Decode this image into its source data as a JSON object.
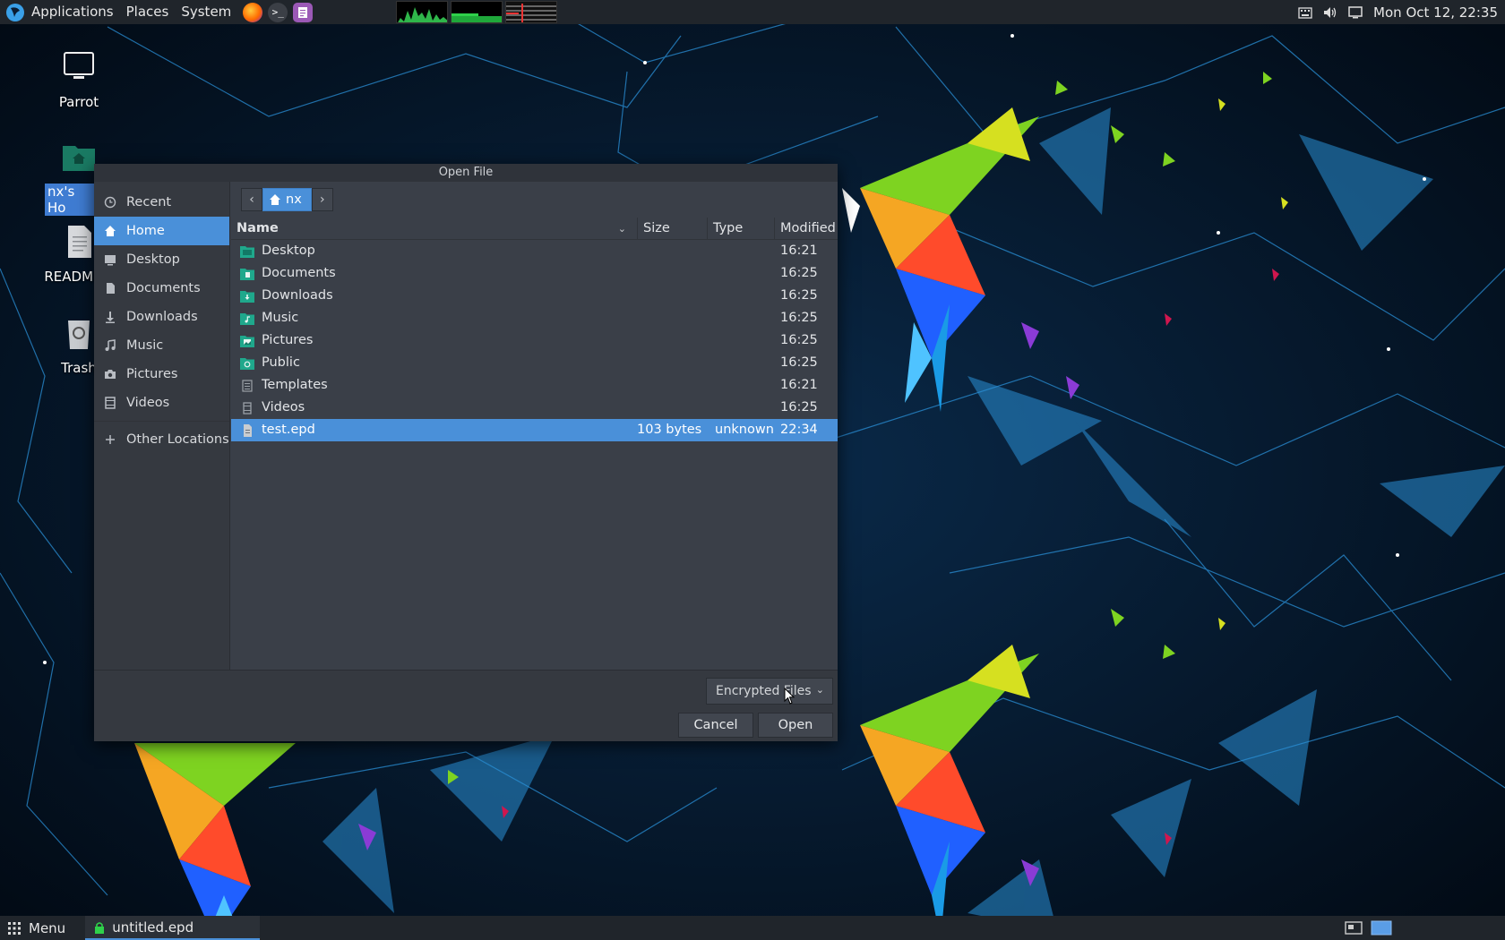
{
  "top_panel": {
    "menus": [
      "Applications",
      "Places",
      "System"
    ],
    "clock": "Mon Oct 12, 22:35"
  },
  "desktop": {
    "icons": [
      {
        "label": "Parrot"
      },
      {
        "label": "nx's Ho"
      },
      {
        "label": "README.li"
      },
      {
        "label": "Trash"
      }
    ]
  },
  "dialog": {
    "title": "Open File",
    "sidebar": [
      {
        "label": "Recent",
        "icon": "clock-icon"
      },
      {
        "label": "Home",
        "icon": "home-icon"
      },
      {
        "label": "Desktop",
        "icon": "desktop-icon"
      },
      {
        "label": "Documents",
        "icon": "document-icon"
      },
      {
        "label": "Downloads",
        "icon": "download-icon"
      },
      {
        "label": "Music",
        "icon": "music-icon"
      },
      {
        "label": "Pictures",
        "icon": "camera-icon"
      },
      {
        "label": "Videos",
        "icon": "film-icon"
      },
      {
        "label": "Other Locations",
        "icon": "plus-icon"
      }
    ],
    "path": {
      "crumb": "nx"
    },
    "columns": {
      "name": "Name",
      "size": "Size",
      "type": "Type",
      "modified": "Modified"
    },
    "files": [
      {
        "name": "Desktop",
        "size": "",
        "type": "",
        "modified": "16:21"
      },
      {
        "name": "Documents",
        "size": "",
        "type": "",
        "modified": "16:25"
      },
      {
        "name": "Downloads",
        "size": "",
        "type": "",
        "modified": "16:25"
      },
      {
        "name": "Music",
        "size": "",
        "type": "",
        "modified": "16:25"
      },
      {
        "name": "Pictures",
        "size": "",
        "type": "",
        "modified": "16:25"
      },
      {
        "name": "Public",
        "size": "",
        "type": "",
        "modified": "16:25"
      },
      {
        "name": "Templates",
        "size": "",
        "type": "",
        "modified": "16:21"
      },
      {
        "name": "Videos",
        "size": "",
        "type": "",
        "modified": "16:25"
      },
      {
        "name": "test.epd",
        "size": "103 bytes",
        "type": "unknown",
        "modified": "22:34"
      }
    ],
    "filter": "Encrypted Files",
    "cancel_label": "Cancel",
    "open_label": "Open"
  },
  "bottom_panel": {
    "menu_label": "Menu",
    "task_label": "untitled.epd"
  },
  "colors": {
    "accent": "#4a90d9",
    "panel": "#20252b",
    "dialog_bg": "#3a3f48",
    "folder": "#1fa88c"
  }
}
